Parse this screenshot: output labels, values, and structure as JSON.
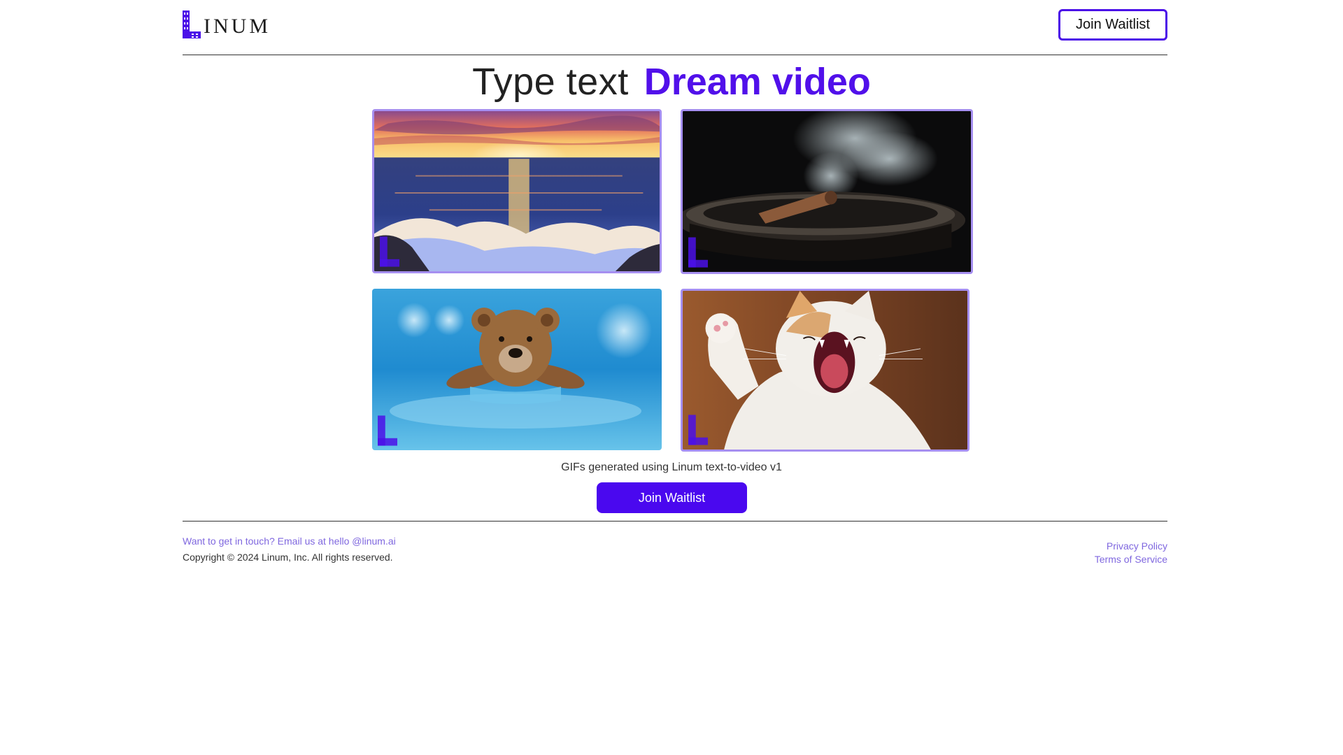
{
  "header": {
    "logo_text": "INUM",
    "join_label": "Join Waitlist"
  },
  "hero": {
    "light_text": "Type text",
    "bold_text": "Dream video"
  },
  "gallery": {
    "items": [
      {
        "subject": "sunset over ocean waves"
      },
      {
        "subject": "smoking cigar in ashtray"
      },
      {
        "subject": "teddy bear swimming"
      },
      {
        "subject": "yawning cat"
      }
    ],
    "caption": "GIFs generated using Linum text-to-video v1",
    "cta_label": "Join Waitlist"
  },
  "footer": {
    "contact": "Want to get in touch? Email us at hello @linum.ai",
    "copyright": "Copyright © 2024 Linum, Inc. All rights reserved.",
    "privacy": "Privacy Policy",
    "terms": "Terms of Service"
  },
  "colors": {
    "brand": "#4b10e8",
    "accent_text": "#5110ea",
    "link": "#7f67df"
  }
}
